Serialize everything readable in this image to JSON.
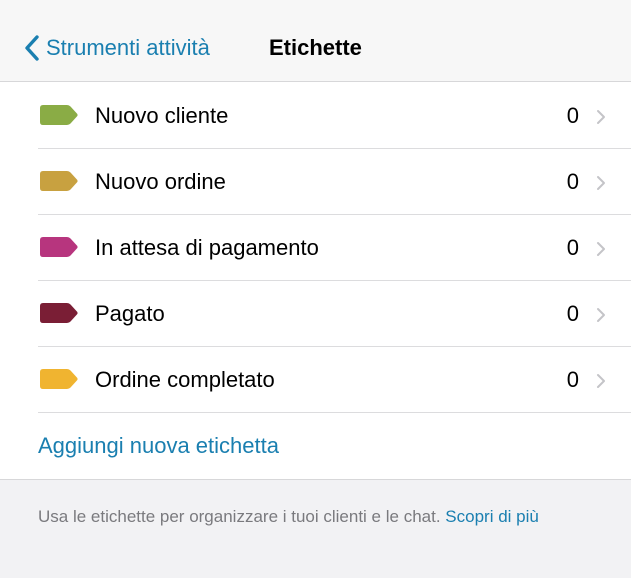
{
  "navbar": {
    "back_label": "Strumenti attività",
    "title": "Etichette"
  },
  "labels": [
    {
      "name": "Nuovo cliente",
      "count": "0",
      "color": "#8aac45"
    },
    {
      "name": "Nuovo ordine",
      "count": "0",
      "color": "#c8a140"
    },
    {
      "name": "In attesa di pagamento",
      "count": "0",
      "color": "#b7357e"
    },
    {
      "name": "Pagato",
      "count": "0",
      "color": "#7a1e35"
    },
    {
      "name": "Ordine completato",
      "count": "0",
      "color": "#f0b430"
    }
  ],
  "add_label": "Aggiungi nuova etichetta",
  "footer": {
    "text": "Usa le etichette per organizzare i tuoi clienti e le chat.",
    "link": "Scopri di più"
  },
  "colors": {
    "accent": "#1a7fb0",
    "chevron": "#c4c4c8"
  },
  "icons": {
    "back": "chevron-left-icon",
    "label": "label-tag-icon",
    "disclosure": "chevron-right-icon"
  }
}
